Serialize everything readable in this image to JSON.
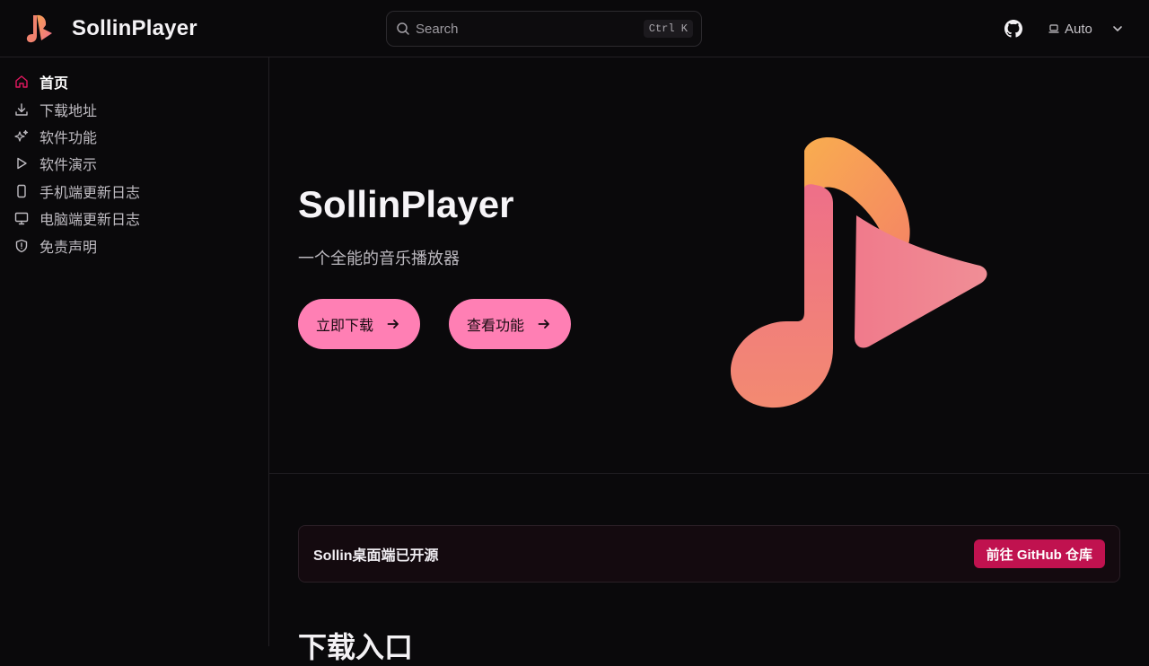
{
  "header": {
    "app_name": "SollinPlayer",
    "search_placeholder": "Search",
    "search_shortcut": "Ctrl K",
    "theme_label": "Auto",
    "icons": [
      "music-logo-icon",
      "search-icon",
      "github-icon",
      "laptop-icon",
      "chevron-down-icon"
    ]
  },
  "sidebar": {
    "items": [
      {
        "label": "首页",
        "icon": "home-icon",
        "active": true
      },
      {
        "label": "下载地址",
        "icon": "download-icon",
        "active": false
      },
      {
        "label": "软件功能",
        "icon": "sparkles-icon",
        "active": false
      },
      {
        "label": "软件演示",
        "icon": "play-icon",
        "active": false
      },
      {
        "label": "手机端更新日志",
        "icon": "smartphone-icon",
        "active": false
      },
      {
        "label": "电脑端更新日志",
        "icon": "monitor-icon",
        "active": false
      },
      {
        "label": "免责声明",
        "icon": "shield-icon",
        "active": false
      }
    ]
  },
  "hero": {
    "title": "SollinPlayer",
    "subtitle": "一个全能的音乐播放器",
    "primary_button": "立即下载",
    "secondary_button": "查看功能"
  },
  "banner": {
    "text": "Sollin桌面端已开源",
    "button": "前往 GitHub 仓库"
  },
  "section": {
    "title": "下载入口"
  },
  "colors": {
    "accent": "#ff7fb4",
    "active_icon": "#e0185f",
    "banner_button": "#c0124f",
    "background": "#0a090b",
    "logo_orange": "#f6a052",
    "logo_pink": "#f27a8e"
  }
}
